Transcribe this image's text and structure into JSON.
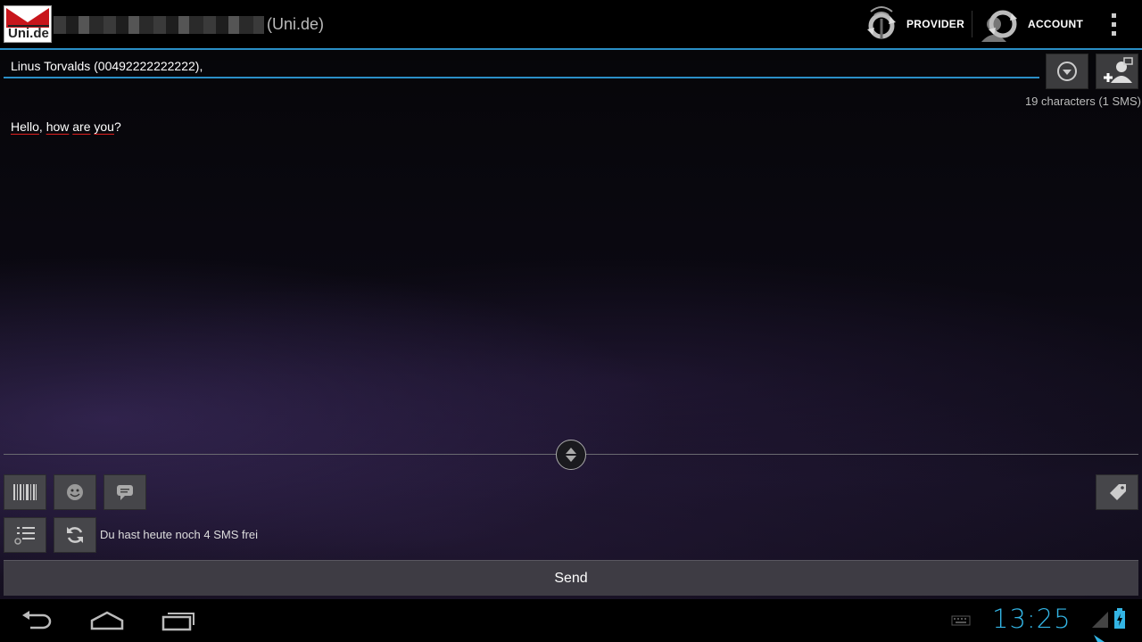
{
  "actionbar": {
    "logo_text": "Uni.de",
    "title_suffix": "(Uni.de)",
    "provider_label": "PROVIDER",
    "account_label": "ACCOUNT"
  },
  "compose": {
    "recipient": "Linus Torvalds (00492222222222),",
    "char_count": "19 characters (1 SMS)",
    "message_words": [
      "Hello",
      "how",
      "are",
      "you"
    ]
  },
  "tools": {
    "free_sms_text": "Du hast heute noch 4 SMS frei"
  },
  "send_label": "Send",
  "statusbar": {
    "clock": "13:25"
  },
  "colors": {
    "accent": "#33b5e5",
    "focus_line": "#2a8fc7",
    "logo_red": "#c8151b"
  }
}
